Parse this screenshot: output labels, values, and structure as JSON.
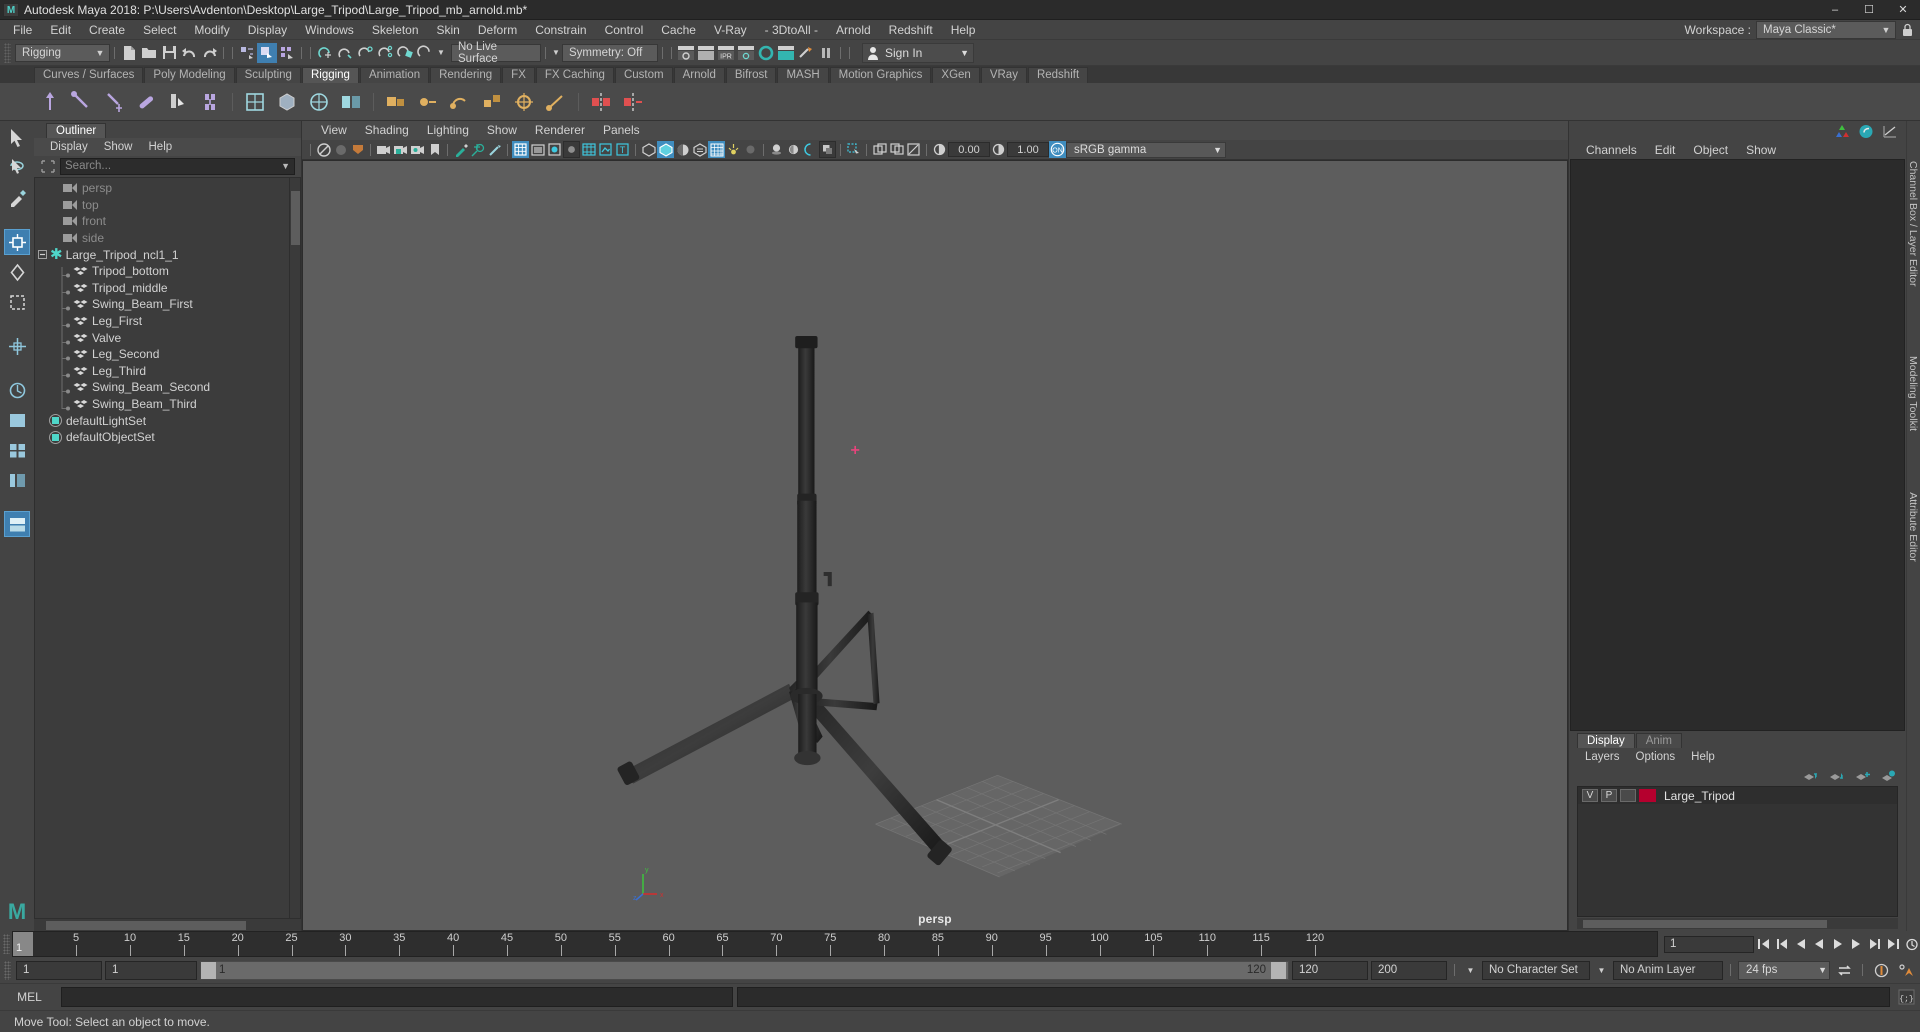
{
  "window": {
    "title": "Autodesk Maya 2018: P:\\Users\\Avdenton\\Desktop\\Large_Tripod\\Large_Tripod_mb_arnold.mb*",
    "logo_text": "M",
    "minimize": "–",
    "maximize": "☐",
    "close": "✕"
  },
  "menubar": {
    "items": [
      "File",
      "Edit",
      "Create",
      "Select",
      "Modify",
      "Display",
      "Windows",
      "Skeleton",
      "Skin",
      "Deform",
      "Constrain",
      "Control",
      "Cache",
      "V-Ray",
      "- 3DtoAll -",
      "Arnold",
      "Redshift",
      "Help"
    ]
  },
  "statusline": {
    "menuset": "Rigging",
    "live_surface": "No Live Surface",
    "symmetry": "Symmetry: Off",
    "signin": "Sign In",
    "workspace_label": "Workspace :",
    "workspace_value": "Maya Classic*"
  },
  "shelf": {
    "tabs": [
      "Curves / Surfaces",
      "Poly Modeling",
      "Sculpting",
      "Rigging",
      "Animation",
      "Rendering",
      "FX",
      "FX Caching",
      "Custom",
      "Arnold",
      "Bifrost",
      "MASH",
      "Motion Graphics",
      "XGen",
      "VRay",
      "Redshift"
    ],
    "active_tab": "Rigging"
  },
  "outliner": {
    "tab": "Outliner",
    "menu": [
      "Display",
      "Show",
      "Help"
    ],
    "search_placeholder": "Search...",
    "items": [
      {
        "label": "persp",
        "icon": "camera-icon",
        "depth": 1,
        "dim": true
      },
      {
        "label": "top",
        "icon": "camera-icon",
        "depth": 1,
        "dim": true
      },
      {
        "label": "front",
        "icon": "camera-icon",
        "depth": 1,
        "dim": true
      },
      {
        "label": "side",
        "icon": "camera-icon",
        "depth": 1,
        "dim": true
      },
      {
        "label": "Large_Tripod_ncl1_1",
        "icon": "star-icon",
        "depth": 0,
        "dim": false,
        "expander": "−"
      },
      {
        "label": "Tripod_bottom",
        "icon": "mesh-icon",
        "depth": 1,
        "dim": false
      },
      {
        "label": "Tripod_middle",
        "icon": "mesh-icon",
        "depth": 1,
        "dim": false
      },
      {
        "label": "Swing_Beam_First",
        "icon": "mesh-icon",
        "depth": 1,
        "dim": false
      },
      {
        "label": "Leg_First",
        "icon": "mesh-icon",
        "depth": 1,
        "dim": false
      },
      {
        "label": "Valve",
        "icon": "mesh-icon",
        "depth": 1,
        "dim": false
      },
      {
        "label": "Leg_Second",
        "icon": "mesh-icon",
        "depth": 1,
        "dim": false
      },
      {
        "label": "Leg_Third",
        "icon": "mesh-icon",
        "depth": 1,
        "dim": false
      },
      {
        "label": "Swing_Beam_Second",
        "icon": "mesh-icon",
        "depth": 1,
        "dim": false
      },
      {
        "label": "Swing_Beam_Third",
        "icon": "mesh-icon",
        "depth": 1,
        "dim": false
      },
      {
        "label": "defaultLightSet",
        "icon": "set-icon",
        "depth": 0,
        "dim": false
      },
      {
        "label": "defaultObjectSet",
        "icon": "set-icon",
        "depth": 0,
        "dim": false
      }
    ]
  },
  "viewport": {
    "menu": [
      "View",
      "Shading",
      "Lighting",
      "Show",
      "Renderer",
      "Panels"
    ],
    "exposure_value": "0.00",
    "gamma_value": "1.00",
    "color_space": "sRGB gamma",
    "camera_label": "persp",
    "axis_x": "x",
    "axis_y": "y",
    "axis_z": "z"
  },
  "channelbox": {
    "menu": [
      "Channels",
      "Edit",
      "Object",
      "Show"
    ],
    "vertical_tabs": [
      "Channel Box / Layer Editor",
      "Modeling Toolkit",
      "Attribute Editor"
    ]
  },
  "layers": {
    "tabs": [
      "Display",
      "Anim"
    ],
    "active_tab": "Display",
    "menu": [
      "Layers",
      "Options",
      "Help"
    ],
    "rows": [
      {
        "visibility": "V",
        "playback": "P",
        "shading": "",
        "color": "#b5002e",
        "name": "Large_Tripod"
      }
    ]
  },
  "timeline": {
    "ticks": [
      1,
      5,
      10,
      15,
      20,
      25,
      30,
      35,
      40,
      45,
      50,
      55,
      60,
      65,
      70,
      75,
      80,
      85,
      90,
      95,
      100,
      105,
      110,
      115,
      120
    ],
    "current_frame": "1",
    "current_frame_field": "1",
    "range_start": "1",
    "range_start_field": "1",
    "range_slider_start": "1",
    "range_slider_end": "120",
    "range_end_field": "120",
    "playback_end_field": "200",
    "character_set": "No Character Set",
    "anim_layer": "No Anim Layer",
    "fps": "24 fps"
  },
  "commandline": {
    "label": "MEL",
    "input_value": ""
  },
  "helpline": {
    "text": "Move Tool: Select an object to move."
  },
  "colors": {
    "accent_blue": "#3f8dbf",
    "teal": "#4fd6c9",
    "orange": "#e08b3a",
    "layer_red": "#b5002e",
    "viewport_bg": "#5d5d5d",
    "tripod": "#2e2e2e"
  }
}
